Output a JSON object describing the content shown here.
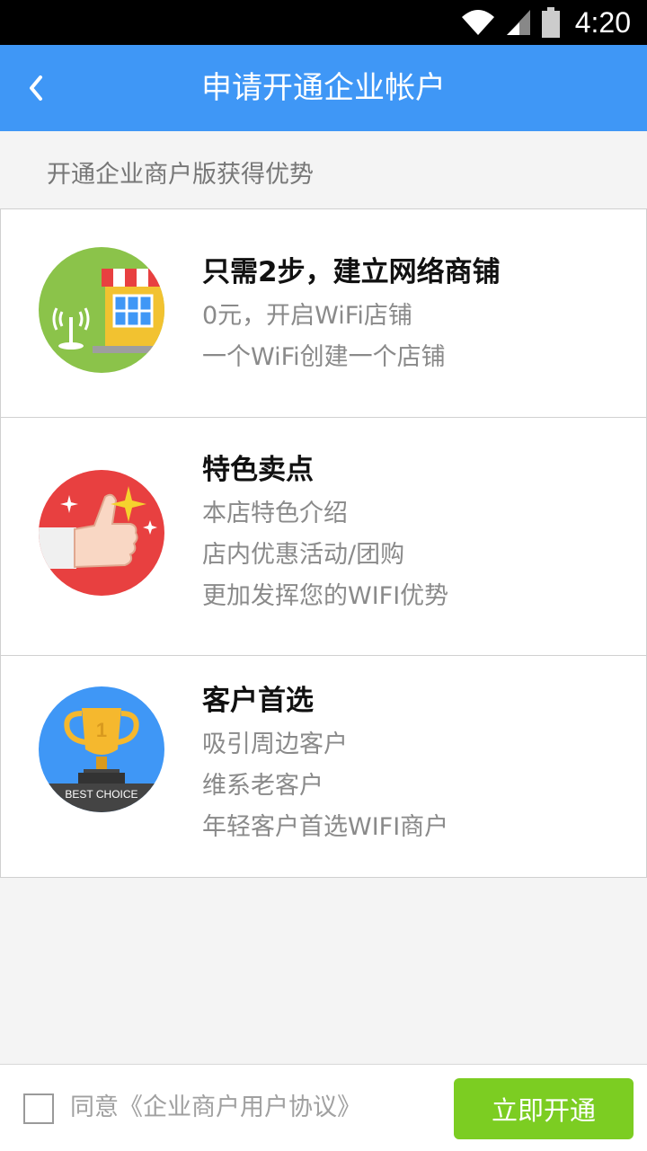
{
  "status_bar": {
    "time": "4:20",
    "icons": [
      "wifi-icon",
      "signal-icon",
      "battery-icon"
    ]
  },
  "nav": {
    "back_icon": "chevron-left-icon",
    "title": "申请开通企业帐户"
  },
  "section_title": "开通企业商户版获得优势",
  "cards": [
    {
      "icon": "shop-wifi-icon",
      "title": "只需2步，建立网络商铺",
      "lines": [
        "0元，开启WiFi店铺",
        "一个WiFi创建一个店铺"
      ]
    },
    {
      "icon": "thumbs-up-icon",
      "title": "特色卖点",
      "lines": [
        "本店特色介绍",
        "店内优惠活动/团购",
        "更加发挥您的WIFI优势"
      ]
    },
    {
      "icon": "trophy-icon",
      "icon_caption": "BEST CHOICE",
      "title": "客户首选",
      "lines": [
        "吸引周边客户",
        "维系老客户",
        "年轻客户首选WIFI商户"
      ]
    }
  ],
  "footer": {
    "agree_checked": false,
    "agree_text": "同意《企业商户用户协议》",
    "open_button": "立即开通"
  },
  "colors": {
    "nav": "#3f97f6",
    "button": "#7ccd22",
    "icon_green": "#8bc34a",
    "icon_red": "#e84040",
    "icon_blue": "#3f97f6"
  }
}
